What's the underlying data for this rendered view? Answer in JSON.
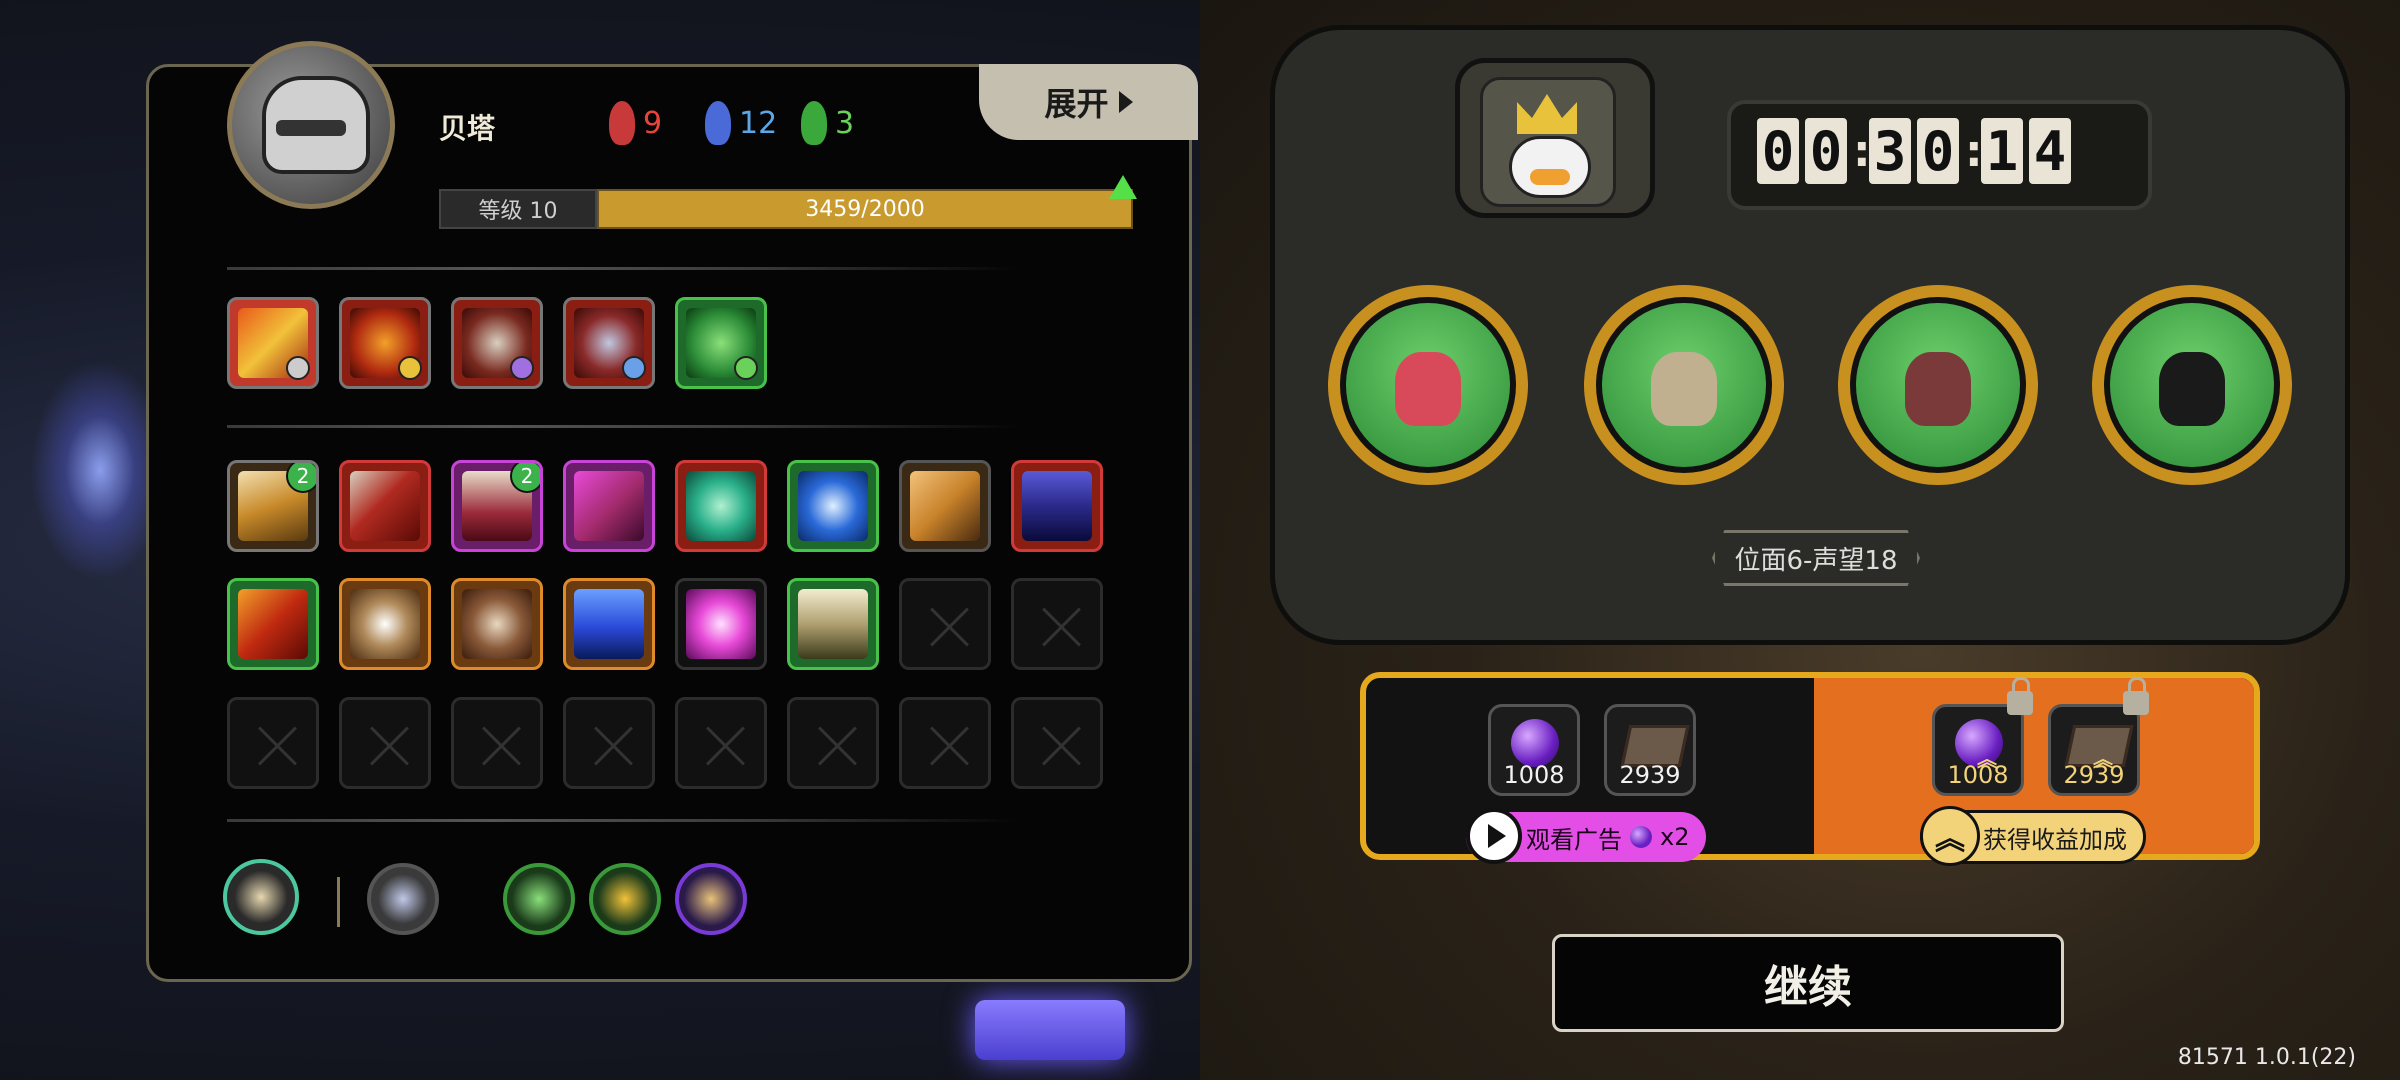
{
  "player": {
    "name": "贝塔",
    "level_label": "等级 10",
    "xp_text": "3459/2000",
    "expand_label": "展开",
    "stats": [
      {
        "icon": "red-mask-icon",
        "value": "9",
        "color": "#e8443a"
      },
      {
        "icon": "blue-mask-icon",
        "value": "12",
        "color": "#5aa8e8"
      },
      {
        "icon": "green-mask-icon",
        "value": "3",
        "color": "#6ad15a"
      }
    ]
  },
  "equipment": [
    {
      "icon": "fire-slash-skill-icon",
      "border": "#c0392b"
    },
    {
      "icon": "flame-demon-skill-icon",
      "border": "#c0392b"
    },
    {
      "icon": "beast-skull-skill-icon",
      "border": "#c0392b"
    },
    {
      "icon": "winged-emblem-skill-icon",
      "border": "#c0392b"
    },
    {
      "icon": "green-shell-skill-icon",
      "border": "#49c24a"
    }
  ],
  "inventory": [
    {
      "icon": "lightning-fist-icon",
      "border": "#d58a2a",
      "badge": "2"
    },
    {
      "icon": "axe-icon",
      "border": "#d23a3a",
      "badge": ""
    },
    {
      "icon": "pillar-icon",
      "border": "#c844d8",
      "badge": "2"
    },
    {
      "icon": "pointing-hand-icon",
      "border": "#c844d8",
      "badge": ""
    },
    {
      "icon": "green-vortex-icon",
      "border": "#d23a3a",
      "badge": ""
    },
    {
      "icon": "blue-burst-icon",
      "border": "#49c24a",
      "badge": ""
    },
    {
      "icon": "chain-path-icon",
      "border": "#444",
      "badge": ""
    },
    {
      "icon": "cat-mask-icon",
      "border": "#d23a3a",
      "badge": ""
    },
    {
      "icon": "red-blade-icon",
      "border": "#49c24a",
      "badge": ""
    },
    {
      "icon": "gear-eye-icon",
      "border": "#e08a2a",
      "badge": ""
    },
    {
      "icon": "mushroom-cloud-icon",
      "border": "#e08a2a",
      "badge": ""
    },
    {
      "icon": "blue-shield-icon",
      "border": "#e08a2a",
      "badge": ""
    },
    {
      "icon": "pink-flame-icon",
      "border": "#333",
      "badge": ""
    },
    {
      "icon": "ribcage-icon",
      "border": "#49c24a",
      "badge": ""
    }
  ],
  "bottom_icons": [
    {
      "icon": "crescent-moon-icon",
      "border": "#4cc8a0"
    },
    {
      "icon": "key-totem-icon",
      "border": "#555"
    },
    {
      "icon": "green-arrows-icon",
      "border": "#3a9a3a"
    },
    {
      "icon": "golden-strike-icon",
      "border": "#3a9a3a"
    },
    {
      "icon": "purple-rune-icon",
      "border": "#7a3ad8"
    }
  ],
  "timer": {
    "digits": [
      "0",
      "0",
      "3",
      "0",
      "1",
      "4"
    ]
  },
  "realm_label": "位面6-声望18",
  "rewards": {
    "base": [
      {
        "icon": "purple-gem-icon",
        "qty": "1008"
      },
      {
        "icon": "book-icon",
        "qty": "2939"
      }
    ],
    "bonus": [
      {
        "icon": "purple-gem-icon",
        "qty": "1008"
      },
      {
        "icon": "book-icon",
        "qty": "2939"
      }
    ],
    "ad_label": "观看广告",
    "ad_multiplier": "x2",
    "boost_label": "获得收益加成"
  },
  "continue_label": "继续",
  "version": "81571 1.0.1(22)"
}
